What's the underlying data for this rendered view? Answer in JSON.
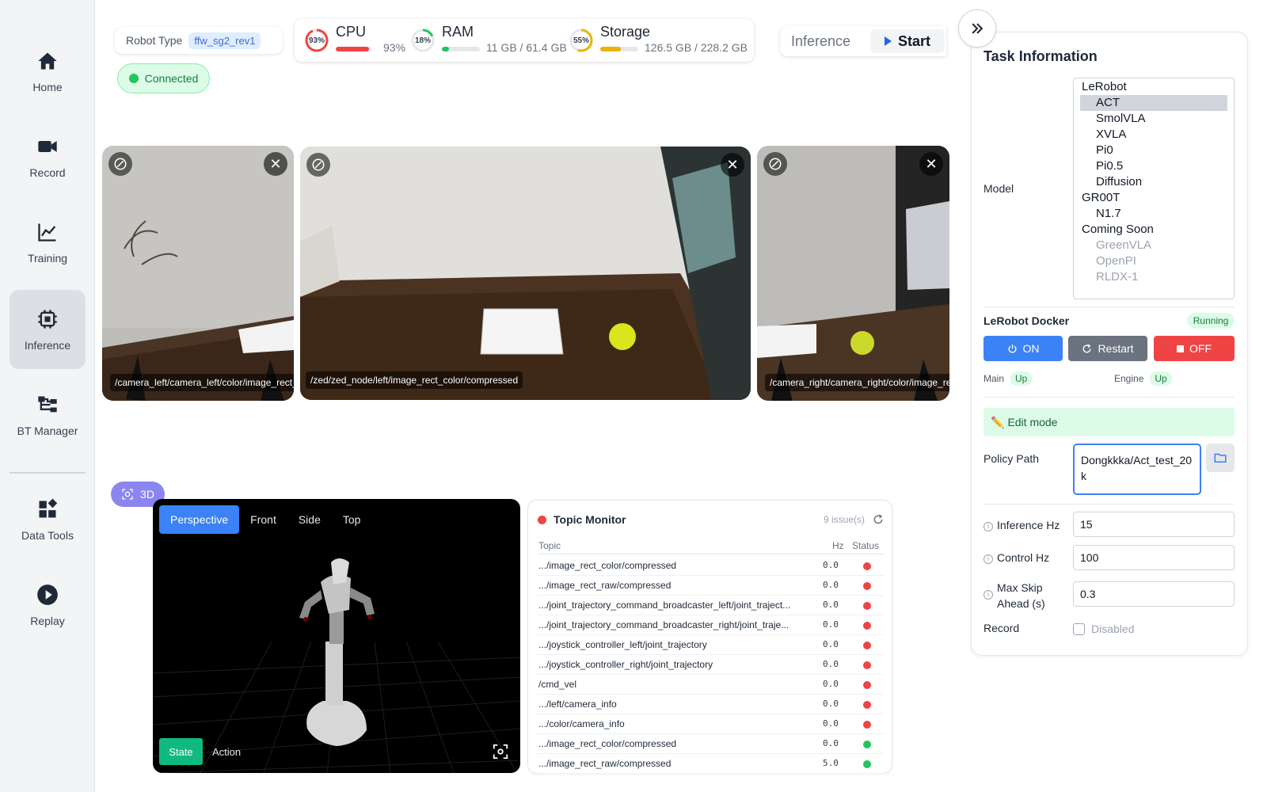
{
  "sidebar": {
    "items": [
      {
        "label": "Home",
        "icon": "home-icon"
      },
      {
        "label": "Record",
        "icon": "video-camera-icon"
      },
      {
        "label": "Training",
        "icon": "line-chart-icon"
      },
      {
        "label": "Inference",
        "icon": "chip-icon",
        "active": true
      },
      {
        "label": "BT Manager",
        "icon": "tree-structure-icon"
      },
      {
        "label": "Data Tools",
        "icon": "widgets-icon"
      },
      {
        "label": "Replay",
        "icon": "play-circle-icon"
      }
    ]
  },
  "header": {
    "robot_type_label": "Robot Type",
    "robot_type_value": "ffw_sg2_rev1",
    "connection_status": "Connected",
    "stats": {
      "cpu": {
        "name": "CPU",
        "percent_label": "93%",
        "value": "93%",
        "percent": 93,
        "color": "#ef4444"
      },
      "ram": {
        "name": "RAM",
        "percent_label": "18%",
        "value": "11 GB / 61.4 GB",
        "percent": 18,
        "color": "#22c55e"
      },
      "storage": {
        "name": "Storage",
        "percent_label": "55%",
        "value": "126.5 GB / 228.2 GB",
        "percent": 55,
        "color": "#eab308"
      }
    },
    "mode_label": "Inference",
    "start_label": "Start"
  },
  "cameras": [
    {
      "topic": "/camera_left/camera_left/color/image_rect_raw/compressed"
    },
    {
      "topic": "/zed/zed_node/left/image_rect_color/compressed"
    },
    {
      "topic": "/camera_right/camera_right/color/image_rect_raw/compressed"
    }
  ],
  "viewer": {
    "toggle_label": "3D",
    "tabs": [
      "Perspective",
      "Front",
      "Side",
      "Top"
    ],
    "active_tab": "Perspective",
    "state_label": "State",
    "action_label": "Action"
  },
  "topic_monitor": {
    "title": "Topic Monitor",
    "issues": "9 issue(s)",
    "columns": {
      "topic": "Topic",
      "hz": "Hz",
      "status": "Status"
    },
    "rows": [
      {
        "topic": ".../image_rect_color/compressed",
        "hz": "0.0",
        "status": "error"
      },
      {
        "topic": ".../image_rect_raw/compressed",
        "hz": "0.0",
        "status": "error"
      },
      {
        "topic": ".../joint_trajectory_command_broadcaster_left/joint_traject...",
        "hz": "0.0",
        "status": "error"
      },
      {
        "topic": ".../joint_trajectory_command_broadcaster_right/joint_traje...",
        "hz": "0.0",
        "status": "error"
      },
      {
        "topic": ".../joystick_controller_left/joint_trajectory",
        "hz": "0.0",
        "status": "error"
      },
      {
        "topic": ".../joystick_controller_right/joint_trajectory",
        "hz": "0.0",
        "status": "error"
      },
      {
        "topic": "/cmd_vel",
        "hz": "0.0",
        "status": "error"
      },
      {
        "topic": ".../left/camera_info",
        "hz": "0.0",
        "status": "error"
      },
      {
        "topic": ".../color/camera_info",
        "hz": "0.0",
        "status": "error"
      },
      {
        "topic": ".../image_rect_color/compressed",
        "hz": "0.0",
        "status": "ok"
      },
      {
        "topic": ".../image_rect_raw/compressed",
        "hz": "5.0",
        "status": "ok"
      }
    ]
  },
  "task": {
    "title": "Task Information",
    "model_label": "Model",
    "model_groups": [
      {
        "label": "LeRobot",
        "options": [
          {
            "label": "ACT",
            "selected": true
          },
          {
            "label": "SmolVLA"
          },
          {
            "label": "XVLA"
          },
          {
            "label": "Pi0"
          },
          {
            "label": "Pi0.5"
          },
          {
            "label": "Diffusion"
          }
        ]
      },
      {
        "label": "GR00T",
        "options": [
          {
            "label": "N1.7"
          }
        ]
      },
      {
        "label": "Coming Soon",
        "options": [
          {
            "label": "GreenVLA",
            "disabled": true
          },
          {
            "label": "OpenPI",
            "disabled": true
          },
          {
            "label": "RLDX-1",
            "disabled": true
          }
        ]
      }
    ],
    "docker": {
      "title": "LeRobot Docker",
      "status": "Running",
      "on_label": "ON",
      "restart_label": "Restart",
      "off_label": "OFF",
      "services": [
        {
          "name": "Main",
          "status": "Up"
        },
        {
          "name": "Engine",
          "status": "Up"
        }
      ]
    },
    "edit_mode_label": "Edit mode",
    "policy_path_label": "Policy Path",
    "policy_path_value": "Dongkkka/Act_test_20k",
    "inference_hz_label": "Inference Hz",
    "inference_hz_value": "15",
    "control_hz_label": "Control Hz",
    "control_hz_value": "100",
    "max_skip_label_1": "Max Skip",
    "max_skip_label_2": "Ahead (s)",
    "max_skip_value": "0.3",
    "record_label": "Record",
    "record_value": "Disabled"
  },
  "colors": {
    "accent": "#3b82f6",
    "on_button": "#3b82f6",
    "restart_button": "#6b7280",
    "off_button": "#ef4444",
    "status_ok": "#22c55e",
    "status_error": "#ef4444"
  }
}
